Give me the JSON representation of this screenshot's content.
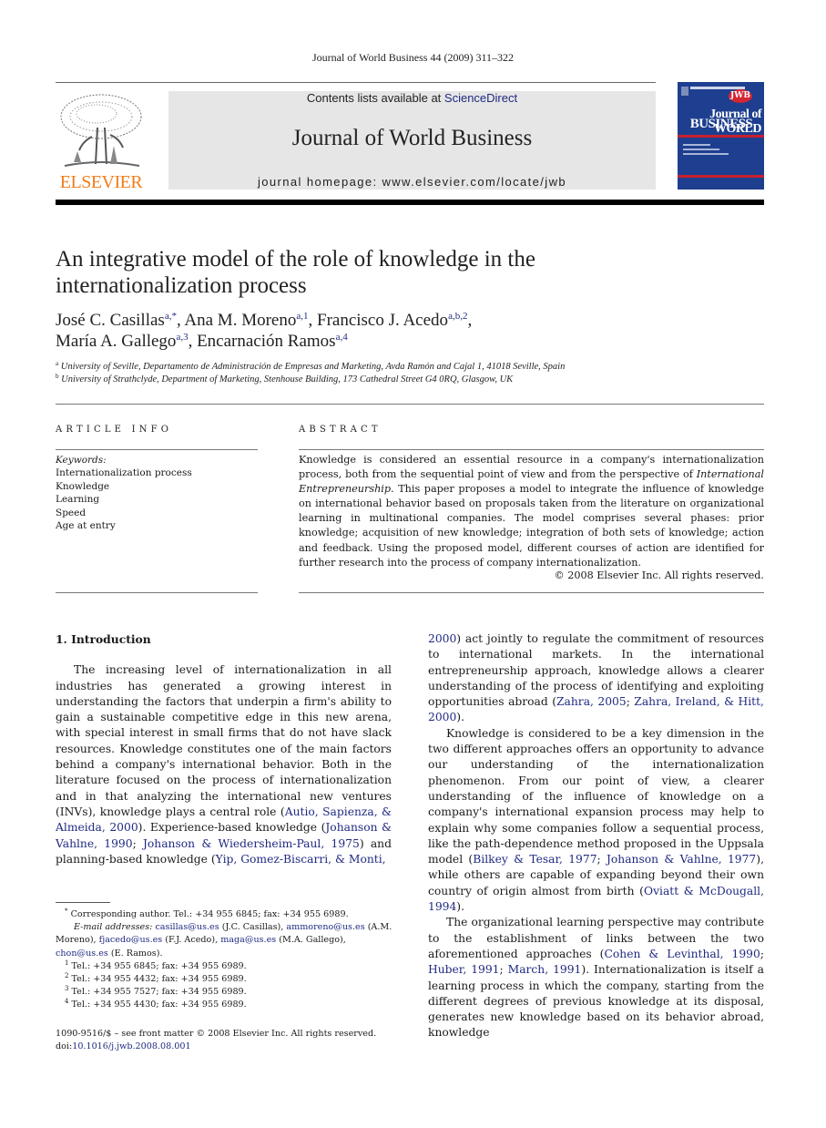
{
  "running_head": "Journal of World Business 44 (2009) 311–322",
  "header": {
    "publisher_logo": "ELSEVIER",
    "contents_prefix": "Contents lists available at ",
    "contents_link": "ScienceDirect",
    "journal_name": "Journal of World Business",
    "homepage": "journal homepage: www.elsevier.com/locate/jwb",
    "cover": {
      "line1": "Journal of WORLD",
      "line2": "BUSINESS",
      "badge": "JWB",
      "brand_color": "#1e3f8f",
      "accent_color": "#c8202f"
    },
    "logo_color": "#f07d1a"
  },
  "article": {
    "title": "An integrative model of the role of knowledge in the internationalization process",
    "authors": [
      {
        "name": "José C. Casillas",
        "marks": "a,*",
        "sep": ", "
      },
      {
        "name": "Ana M. Moreno",
        "marks": "a,1",
        "sep": ", "
      },
      {
        "name": "Francisco J. Acedo",
        "marks": "a,b,2",
        "sep": ","
      },
      {
        "name": "María A. Gallego",
        "marks": "a,3",
        "sep": ", "
      },
      {
        "name": "Encarnación Ramos",
        "marks": "a,4",
        "sep": ""
      }
    ],
    "affiliations": [
      {
        "mark": "a",
        "text": "University of Seville, Departamento de Administración de Empresas and Marketing, Avda Ramón and Cajal 1, 41018 Seville, Spain"
      },
      {
        "mark": "b",
        "text": "University of Strathclyde, Department of Marketing, Stenhouse Building, 173 Cathedral Street G4 0RQ, Glasgow, UK"
      }
    ]
  },
  "article_info": {
    "heading": "ARTICLE INFO",
    "keywords_label": "Keywords:",
    "keywords": [
      "Internationalization process",
      "Knowledge",
      "Learning",
      "Speed",
      "Age at entry"
    ]
  },
  "abstract": {
    "heading": "ABSTRACT",
    "text_1": "Knowledge is considered an essential resource in a company's internationalization process, both from the sequential point of view and from the perspective of ",
    "text_italic": "International Entrepreneurship",
    "text_2": ". This paper proposes a model to integrate the influence of knowledge on international behavior based on proposals taken from the literature on organizational learning in multinational companies. The model comprises several phases: prior knowledge; acquisition of new knowledge; integration of both sets of knowledge; action and feedback. Using the proposed model, different courses of action are identified for further research into the process of company internationalization.",
    "copyright": "© 2008 Elsevier Inc. All rights reserved."
  },
  "intro": {
    "heading": "1.  Introduction",
    "p1": [
      {
        "t": "The increasing level of internationalization in all industries has generated a growing interest in understanding the factors that underpin a firm's ability to gain a sustainable competitive edge in this new arena, with special interest in small firms that do not have slack resources. Knowledge constitutes one of the main factors behind a company's international behavior. Both in the literature focused on the process of internationalization and in that analyzing the international new ventures (INVs), knowledge plays a central role ("
      },
      {
        "t": "Autio, Sapienza, & Almeida, 2000",
        "link": true
      },
      {
        "t": "). Experience-based knowledge ("
      },
      {
        "t": "Johanson & Vahlne, 1990",
        "link": true
      },
      {
        "t": "; "
      },
      {
        "t": "Johanson & Wiedersheim-Paul, 1975",
        "link": true
      },
      {
        "t": ") and planning-based knowledge ("
      },
      {
        "t": "Yip, Gomez-Biscarri, & Monti,",
        "link": true
      }
    ],
    "p1_cont": [
      {
        "t": "2000",
        "link": true
      },
      {
        "t": ") act jointly to regulate the commitment of resources to international markets. In the international entrepreneurship approach, knowledge allows a clearer understanding of the process of identifying and exploiting opportunities abroad ("
      },
      {
        "t": "Zahra, 2005",
        "link": true
      },
      {
        "t": "; "
      },
      {
        "t": "Zahra, Ireland, & Hitt, 2000",
        "link": true
      },
      {
        "t": ")."
      }
    ],
    "p2": [
      {
        "t": "Knowledge is considered to be a key dimension in the two different approaches offers an opportunity to advance our understanding of the internationalization phenomenon. From our point of view, a clearer understanding of the influence of knowledge on a company's international expansion process may help to explain why some companies follow a sequential process, like the path-dependence method proposed in the Uppsala model ("
      },
      {
        "t": "Bilkey & Tesar, 1977",
        "link": true
      },
      {
        "t": "; "
      },
      {
        "t": "Johanson & Vahlne, 1977",
        "link": true
      },
      {
        "t": "), while others are capable of expanding beyond their own country of origin almost from birth ("
      },
      {
        "t": "Oviatt & McDougall, 1994",
        "link": true
      },
      {
        "t": ")."
      }
    ],
    "p3": [
      {
        "t": "The organizational learning perspective may contribute to the establishment of links between the two aforementioned approaches ("
      },
      {
        "t": "Cohen & Levinthal, 1990",
        "link": true
      },
      {
        "t": "; "
      },
      {
        "t": "Huber, 1991",
        "link": true
      },
      {
        "t": "; "
      },
      {
        "t": "March, 1991",
        "link": true
      },
      {
        "t": "). Internationalization is itself a learning process in which the company, starting from the different degrees of previous knowledge at its disposal, generates new knowledge based on its behavior abroad, knowledge"
      }
    ]
  },
  "footnotes": {
    "corresponding": "Corresponding author. Tel.: +34 955 6845; fax: +34 955 6989.",
    "corresponding_mark": "*",
    "email_label": "E-mail addresses:",
    "emails": [
      {
        "email": "casillas@us.es",
        "who": " (J.C. Casillas), "
      },
      {
        "email": "ammoreno@us.es",
        "who": " (A.M. Moreno), "
      },
      {
        "email": "fjacedo@us.es",
        "who": " (F.J. Acedo), "
      },
      {
        "email": "maga@us.es",
        "who": " (M.A. Gallego), "
      },
      {
        "email": "chon@us.es",
        "who": " (E. Ramos)."
      }
    ],
    "notes": [
      {
        "mark": "1",
        "text": "Tel.: +34 955 6845; fax: +34 955 6989."
      },
      {
        "mark": "2",
        "text": "Tel.: +34 955 4432; fax: +34 955 6989."
      },
      {
        "mark": "3",
        "text": "Tel.: +34 955 7527; fax: +34 955 6989."
      },
      {
        "mark": "4",
        "text": "Tel.: +34 955 4430; fax: +34 955 6989."
      }
    ],
    "front_matter": "1090-9516/$ – see front matter © 2008 Elsevier Inc. All rights reserved.",
    "doi_label": "doi:",
    "doi": "10.1016/j.jwb.2008.08.001"
  }
}
